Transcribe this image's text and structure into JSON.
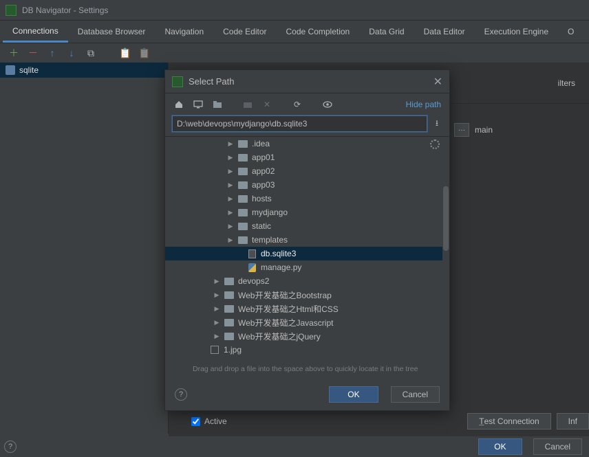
{
  "window": {
    "title": "DB Navigator - Settings"
  },
  "tabs": [
    "Connections",
    "Database Browser",
    "Navigation",
    "Code Editor",
    "Code Completion",
    "Data Grid",
    "Data Editor",
    "Execution Engine",
    "O"
  ],
  "active_tab": 0,
  "sidebar": {
    "items": [
      {
        "label": "sqlite"
      }
    ]
  },
  "right": {
    "filters_label": "ilters",
    "main_label": "main",
    "active_label": "Active",
    "test_conn_label": "Test Connection",
    "info_label": "Inf"
  },
  "footer": {
    "ok_label": "OK",
    "cancel_label": "Cancel"
  },
  "modal": {
    "title": "Select Path",
    "hide_path_label": "Hide path",
    "path_value": "D:\\web\\devops\\mydjango\\db.sqlite3",
    "drop_hint": "Drag and drop a file into the space above to quickly locate it in the tree",
    "ok_label": "OK",
    "cancel_label": "Cancel",
    "tree": [
      {
        "depth": 4,
        "kind": "folder",
        "expandable": true,
        "label": ".idea"
      },
      {
        "depth": 4,
        "kind": "folder",
        "expandable": true,
        "label": "app01"
      },
      {
        "depth": 4,
        "kind": "folder",
        "expandable": true,
        "label": "app02"
      },
      {
        "depth": 4,
        "kind": "folder",
        "expandable": true,
        "label": "app03"
      },
      {
        "depth": 4,
        "kind": "folder",
        "expandable": true,
        "label": "hosts"
      },
      {
        "depth": 4,
        "kind": "folder",
        "expandable": true,
        "label": "mydjango"
      },
      {
        "depth": 4,
        "kind": "folder",
        "expandable": true,
        "label": "static"
      },
      {
        "depth": 4,
        "kind": "folder",
        "expandable": true,
        "label": "templates"
      },
      {
        "depth": 5,
        "kind": "dbfile",
        "expandable": false,
        "label": "db.sqlite3",
        "selected": true
      },
      {
        "depth": 5,
        "kind": "pyfile",
        "expandable": false,
        "label": "manage.py"
      },
      {
        "depth": 3,
        "kind": "folder",
        "expandable": true,
        "label": "devops2"
      },
      {
        "depth": 3,
        "kind": "folder",
        "expandable": true,
        "label": "Web开发基础之Bootstrap"
      },
      {
        "depth": 3,
        "kind": "folder",
        "expandable": true,
        "label": "Web开发基础之Html和CSS"
      },
      {
        "depth": 3,
        "kind": "folder",
        "expandable": true,
        "label": "Web开发基础之Javascript"
      },
      {
        "depth": 3,
        "kind": "folder",
        "expandable": true,
        "label": "Web开发基础之jQuery"
      },
      {
        "depth": 2,
        "kind": "image",
        "expandable": false,
        "label": "1.jpg"
      }
    ]
  },
  "icons": {
    "plus": "＋",
    "minus": "－",
    "up": "↑",
    "down": "↓",
    "copy": "⧉",
    "paste": "📋",
    "paste_disabled": "📋",
    "home": "⌂",
    "desktop": "🖥",
    "project": "📁",
    "newfolder": "📁",
    "delete": "✕",
    "refresh": "⟳",
    "show": "👁"
  }
}
